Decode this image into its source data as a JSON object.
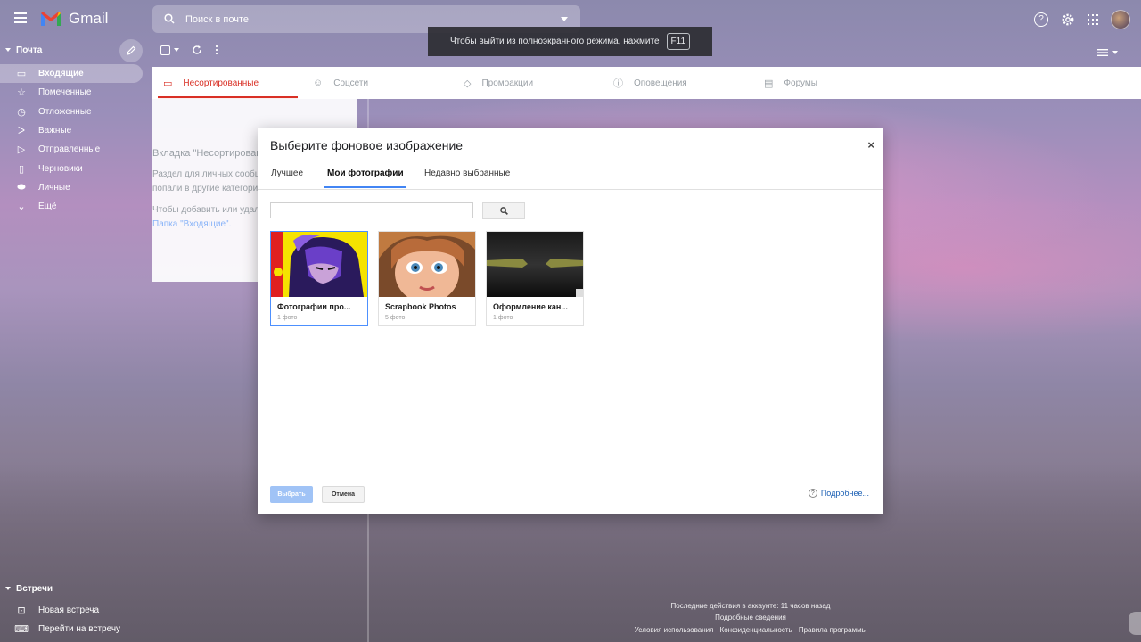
{
  "header": {
    "app_name": "Gmail",
    "search_placeholder": "Поиск в почте"
  },
  "toast": {
    "text": "Чтобы выйти из полноэкранного режима, нажмите",
    "key": "F11"
  },
  "sidebar": {
    "section_title": "Почта",
    "items": [
      {
        "label": "Входящие",
        "icon": "inbox-icon"
      },
      {
        "label": "Помеченные",
        "icon": "star-icon"
      },
      {
        "label": "Отложенные",
        "icon": "clock-icon"
      },
      {
        "label": "Важные",
        "icon": "important-icon"
      },
      {
        "label": "Отправленные",
        "icon": "send-icon"
      },
      {
        "label": "Черновики",
        "icon": "draft-icon"
      },
      {
        "label": "Личные",
        "icon": "label-icon"
      },
      {
        "label": "Ещё",
        "icon": "chevron-down-icon"
      }
    ],
    "meet_title": "Встречи",
    "meet_items": [
      {
        "label": "Новая встреча",
        "icon": "video-icon"
      },
      {
        "label": "Перейти на встречу",
        "icon": "keyboard-icon"
      }
    ]
  },
  "category_tabs": [
    {
      "label": "Несортированные",
      "icon": "inbox-icon"
    },
    {
      "label": "Соцсети",
      "icon": "people-icon"
    },
    {
      "label": "Промоакции",
      "icon": "tag-icon"
    },
    {
      "label": "Оповещения",
      "icon": "info-icon"
    },
    {
      "label": "Форумы",
      "icon": "forum-icon"
    }
  ],
  "empty_panel": {
    "line1": "Вкладка \"Несортирован",
    "line2": "Раздел для личных сообще",
    "line3": "попали в другие категории",
    "line4": "Чтобы добавить или удали",
    "link": "Папка \"Входящие\"."
  },
  "dialog": {
    "title": "Выберите фоновое изображение",
    "close": "×",
    "tabs": [
      "Лучшее",
      "Мои фотографии",
      "Недавно выбранные"
    ],
    "active_tab": "Мои фотографии",
    "albums": [
      {
        "name": "Фотографии про...",
        "count": "1 фото"
      },
      {
        "name": "Scrapbook Photos",
        "count": "5 фото"
      },
      {
        "name": "Оформление кан...",
        "count": "1 фото"
      }
    ],
    "select_button": "Выбрать",
    "cancel_button": "Отмена",
    "more_link": "Подробнее..."
  },
  "footer": {
    "activity": "Последние действия в аккаунте: 11 часов назад",
    "details": "Подробные сведения",
    "links": "Условия использования · Конфиденциальность · Правила программы"
  }
}
